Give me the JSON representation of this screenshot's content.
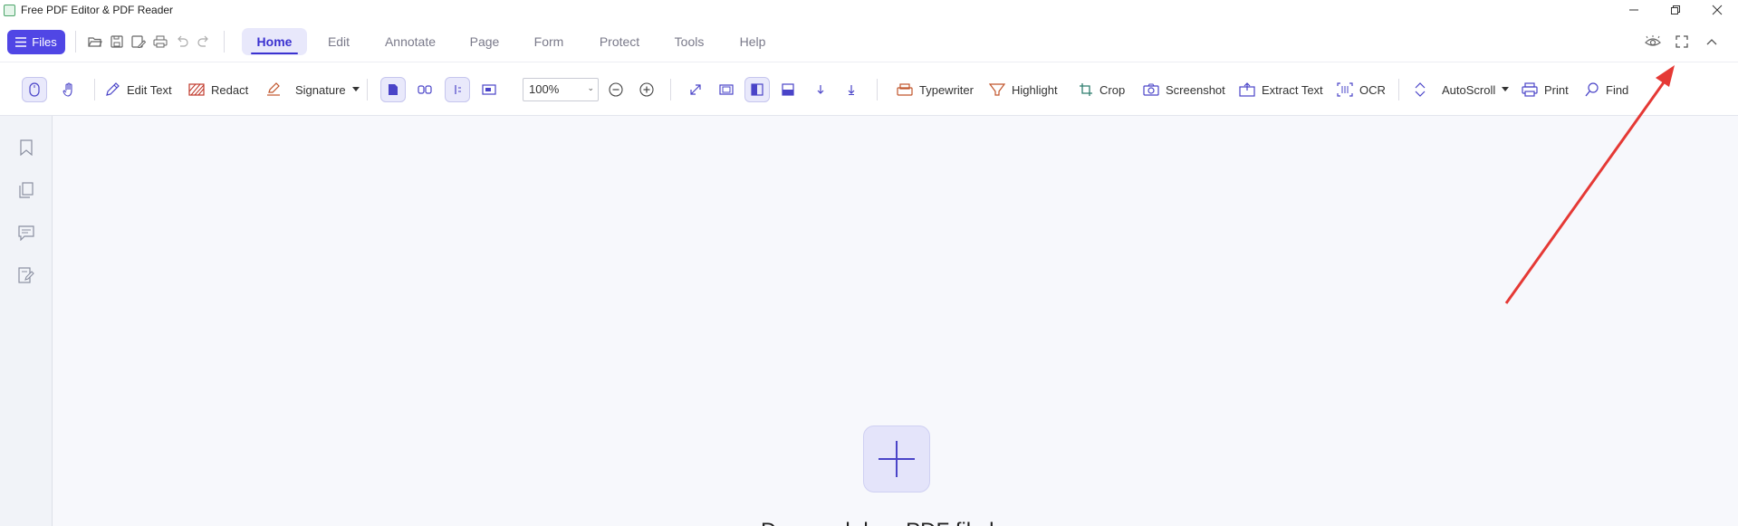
{
  "window": {
    "title": "Free PDF Editor & PDF Reader"
  },
  "menubar": {
    "files_label": "Files",
    "tabs": [
      {
        "label": "Home",
        "active": true
      },
      {
        "label": "Edit"
      },
      {
        "label": "Annotate"
      },
      {
        "label": "Page"
      },
      {
        "label": "Form"
      },
      {
        "label": "Protect"
      },
      {
        "label": "Tools"
      },
      {
        "label": "Help"
      }
    ]
  },
  "toolbar": {
    "edit_text": "Edit Text",
    "redact": "Redact",
    "signature": "Signature",
    "zoom_value": "100%",
    "typewriter": "Typewriter",
    "highlight": "Highlight",
    "crop": "Crop",
    "screenshot": "Screenshot",
    "extract_text": "Extract Text",
    "ocr": "OCR",
    "autoscroll": "AutoScroll",
    "print": "Print",
    "find": "Find"
  },
  "main": {
    "open_text": "Drag and drop PDF file here"
  },
  "colors": {
    "accent": "#5046e5",
    "annotation_arrow": "#e53935"
  }
}
